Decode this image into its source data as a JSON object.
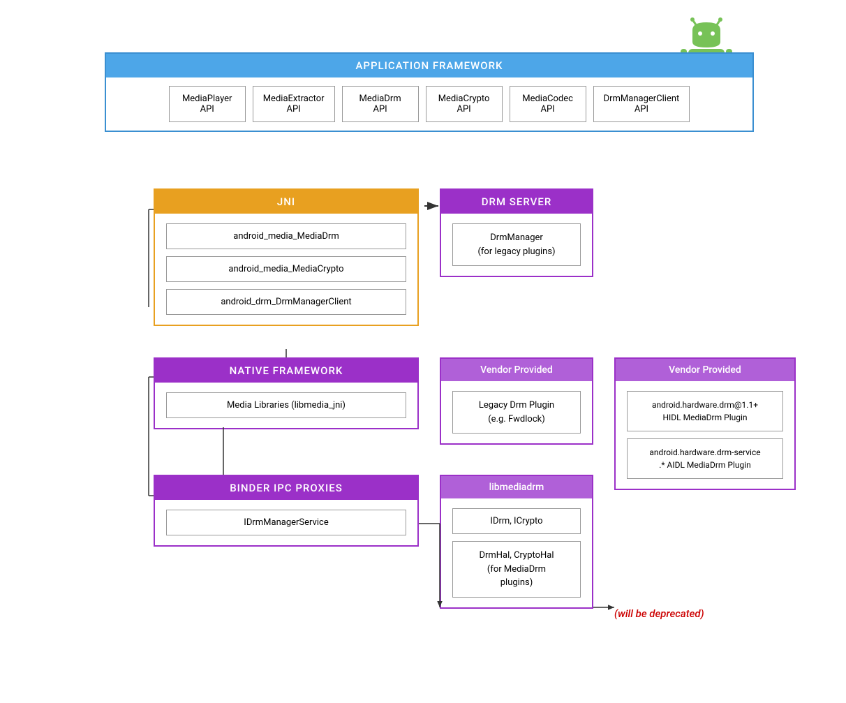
{
  "android_logo": {
    "alt": "Android Logo"
  },
  "app_framework": {
    "header": "APPLICATION FRAMEWORK",
    "apis": [
      {
        "label": "MediaPlayer\nAPI"
      },
      {
        "label": "MediaExtractor\nAPI"
      },
      {
        "label": "MediaDrm\nAPI"
      },
      {
        "label": "MediaCrypto\nAPI"
      },
      {
        "label": "MediaCodec\nAPI"
      },
      {
        "label": "DrmManagerClient\nAPI"
      }
    ]
  },
  "jni": {
    "header": "JNI",
    "items": [
      "android_media_MediaDrm",
      "android_media_MediaCrypto",
      "android_drm_DrmManagerClient"
    ]
  },
  "native_framework": {
    "header": "NATIVE FRAMEWORK",
    "items": [
      "Media Libraries (libmedia_jni)"
    ]
  },
  "binder_ipc": {
    "header": "BINDER IPC PROXIES",
    "items": [
      "IDrmManagerService"
    ]
  },
  "drm_server": {
    "header": "DRM SERVER",
    "items": [
      "DrmManager\n(for legacy plugins)"
    ]
  },
  "vendor_left": {
    "header": "Vendor Provided",
    "items": [
      "Legacy Drm Plugin\n(e.g. Fwdlock)"
    ]
  },
  "vendor_right": {
    "header": "Vendor Provided",
    "items": [
      "android.hardware.drm@1.1+\nHIDL MediaDrm Plugin",
      "android.hardware.drm-service\n.* AIDL MediaDrm Plugin"
    ]
  },
  "libmedia": {
    "header": "libmediadrm",
    "items": [
      "IDrm, ICrypto",
      "DrmHal, CryptoHal\n(for MediaDrm\nplugins)"
    ]
  },
  "deprecated": "(will be deprecated)"
}
